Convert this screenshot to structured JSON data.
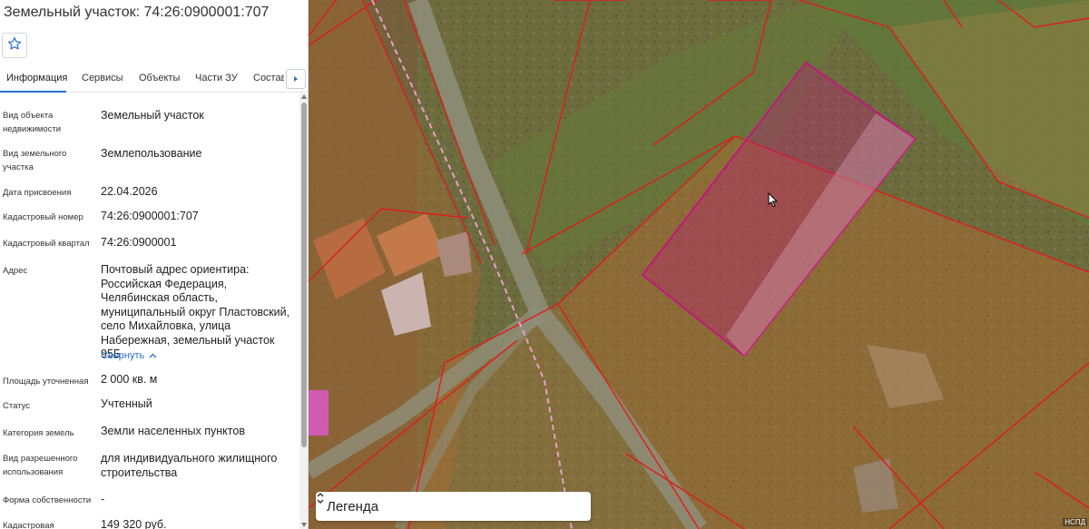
{
  "panel": {
    "title": "Земельный участок: 74:26:0900001:707",
    "tabs": [
      {
        "label": "Информация"
      },
      {
        "label": "Сервисы"
      },
      {
        "label": "Объекты"
      },
      {
        "label": "Части ЗУ"
      },
      {
        "label": "Состав"
      }
    ],
    "active_tab": "Информация",
    "fields": [
      {
        "label": "Вид объекта недвижимости",
        "value": "Земельный участок"
      },
      {
        "label": "Вид земельного участка",
        "value": "Землепользование"
      },
      {
        "label": "Дата присвоения",
        "value": "22.04.2026"
      },
      {
        "label": "Кадастровый номер",
        "value": "74:26:0900001:707"
      },
      {
        "label": "Кадастровый квартал",
        "value": "74:26:0900001"
      },
      {
        "label": "Адрес",
        "value": "Почтовый адрес ориентира: Российская Федерация, Челябинская область, муниципальный округ Пластовский, село Михайловка, улица Набережная, земельный участок 95Б"
      },
      {
        "label": "Площадь уточненная",
        "value": "2 000 кв. м"
      },
      {
        "label": "Статус",
        "value": "Учтенный"
      },
      {
        "label": "Категория земель",
        "value": "Земли населенных пунктов"
      },
      {
        "label": "Вид разрешенного использования",
        "value": "для индивидуального жилищного строительства"
      },
      {
        "label": "Форма собственности",
        "value": "-"
      },
      {
        "label": "Кадастровая",
        "value": "149 320 руб."
      }
    ],
    "collapse_link": "Свернуть"
  },
  "map": {
    "legend_label": "Легенда",
    "attribution": "НСПД",
    "accent_color": "#c0187a",
    "boundary_color": "#e01b1b"
  }
}
